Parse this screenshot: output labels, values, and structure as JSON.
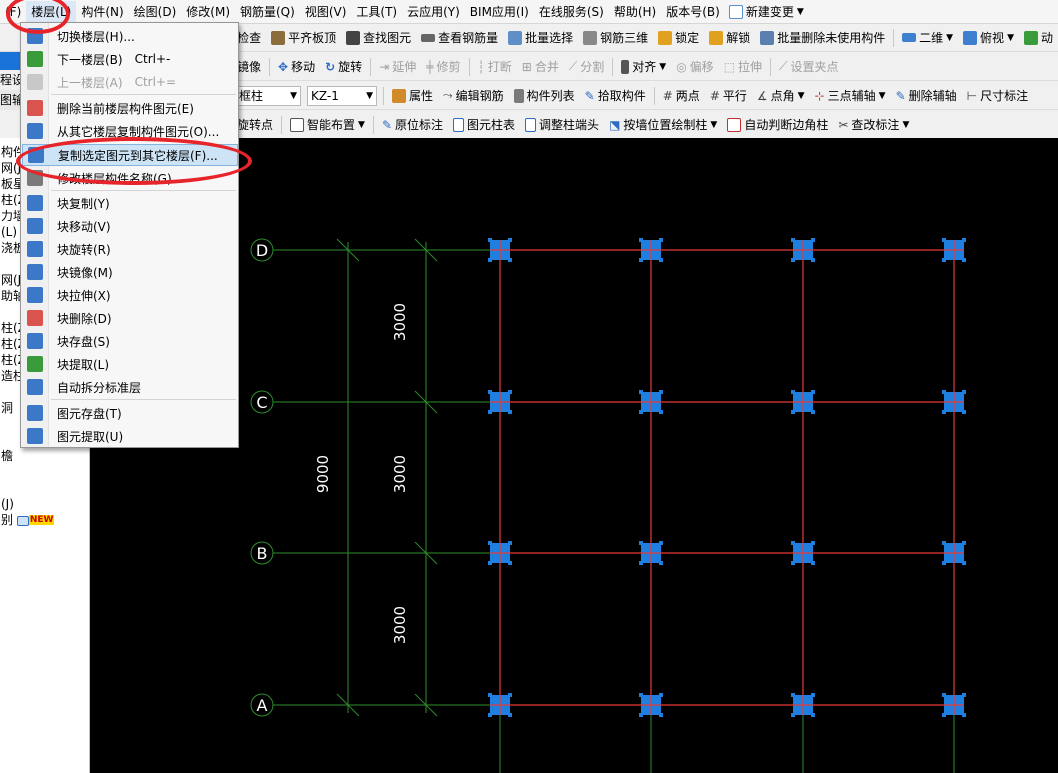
{
  "menubar": {
    "items": [
      "(F)",
      "楼层(L)",
      "构件(N)",
      "绘图(D)",
      "修改(M)",
      "钢筋量(Q)",
      "视图(V)",
      "工具(T)",
      "云应用(Y)",
      "BIM应用(I)",
      "在线服务(S)",
      "帮助(H)",
      "版本号(B)"
    ],
    "new_change": "新建变更"
  },
  "toolbar1": {
    "items": [
      "汇总检查",
      "平齐板顶",
      "查找图元",
      "查看钢筋量",
      "批量选择",
      "钢筋三维",
      "锁定",
      "解锁",
      "批量删除未使用构件",
      "二维",
      "俯视",
      "动"
    ]
  },
  "toolbar2": {
    "items": [
      "镜像",
      "移动",
      "旋转",
      "延伸",
      "修剪",
      "打断",
      "合并",
      "分割",
      "对齐",
      "偏移",
      "拉伸",
      "设置夹点"
    ]
  },
  "toolbar3": {
    "type_value": "框柱",
    "component_value": "KZ-1",
    "items": [
      "属性",
      "编辑钢筋",
      "构件列表",
      "拾取构件",
      "两点",
      "平行",
      "点角",
      "三点辅轴",
      "删除辅轴",
      "尺寸标注"
    ]
  },
  "toolbar4": {
    "items": [
      "旋转点",
      "智能布置",
      "原位标注",
      "图元柱表",
      "调整柱端头",
      "按墙位置绘制柱",
      "自动判断边角柱",
      "查改标注"
    ]
  },
  "left_panel": {
    "top_rows": [
      "程设置",
      "图输入"
    ],
    "tree": [
      "构件名",
      "网(J)",
      "板星",
      "柱(Z)",
      "力墙",
      "(L)",
      "浇板",
      "",
      "网(J)",
      "助轴",
      "",
      "柱(Z)",
      "柱(Z)",
      "柱(Z)",
      "造柱",
      "",
      "洞",
      "",
      "",
      "檐",
      "",
      "",
      "(J)",
      "别"
    ],
    "new_badge": "NEW"
  },
  "floor_menu": {
    "items": [
      {
        "label": "切换楼层(H)...",
        "shortcut": "",
        "disabled": false,
        "icon_color": "#3c78c8"
      },
      {
        "label": "下一楼层(B)",
        "shortcut": "Ctrl+-",
        "disabled": false,
        "icon_color": "#3a9b3a"
      },
      {
        "label": "上一楼层(A)",
        "shortcut": "Ctrl+=",
        "disabled": true,
        "icon_color": "#b7b7b7"
      },
      {
        "label": "删除当前楼层构件图元(E)",
        "shortcut": "",
        "disabled": false,
        "icon_color": "#d9534f"
      },
      {
        "label": "从其它楼层复制构件图元(O)...",
        "shortcut": "",
        "disabled": false,
        "icon_color": "#3c78c8"
      },
      {
        "label": "复制选定图元到其它楼层(F)...",
        "shortcut": "",
        "disabled": false,
        "icon_color": "#3c78c8",
        "highlighted": true
      },
      {
        "label": "修改楼层构件名称(G)...",
        "shortcut": "",
        "disabled": false,
        "icon_color": "#7a7a7a"
      },
      {
        "label": "块复制(Y)",
        "shortcut": "",
        "disabled": false,
        "icon_color": "#3c78c8"
      },
      {
        "label": "块移动(V)",
        "shortcut": "",
        "disabled": false,
        "icon_color": "#3c78c8"
      },
      {
        "label": "块旋转(R)",
        "shortcut": "",
        "disabled": false,
        "icon_color": "#3c78c8"
      },
      {
        "label": "块镜像(M)",
        "shortcut": "",
        "disabled": false,
        "icon_color": "#3c78c8"
      },
      {
        "label": "块拉伸(X)",
        "shortcut": "",
        "disabled": false,
        "icon_color": "#3c78c8"
      },
      {
        "label": "块删除(D)",
        "shortcut": "",
        "disabled": false,
        "icon_color": "#d9534f"
      },
      {
        "label": "块存盘(S)",
        "shortcut": "",
        "disabled": false,
        "icon_color": "#3c78c8"
      },
      {
        "label": "块提取(L)",
        "shortcut": "",
        "disabled": false,
        "icon_color": "#3a9b3a"
      },
      {
        "label": "自动拆分标准层",
        "shortcut": "",
        "disabled": false,
        "icon_color": "#3c78c8"
      },
      {
        "label": "图元存盘(T)",
        "shortcut": "",
        "disabled": false,
        "icon_color": "#3c78c8"
      },
      {
        "label": "图元提取(U)",
        "shortcut": "",
        "disabled": false,
        "icon_color": "#3c78c8"
      }
    ]
  },
  "drawing": {
    "axis_labels": [
      "D",
      "C",
      "B",
      "A"
    ],
    "dimensions": [
      "3000",
      "3000",
      "3000"
    ],
    "total_dimension": "9000",
    "colors": {
      "background": "#000000",
      "beam_line": "#e53935",
      "grid_line": "#2e8b2e",
      "column": "#1e7fe0",
      "annotation": "#e8242b",
      "highlight": "#cde4f7"
    }
  }
}
